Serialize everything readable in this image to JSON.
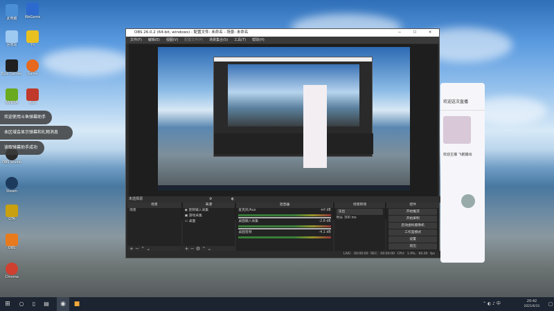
{
  "desktop": {
    "icons": [
      {
        "label": "此电脑",
        "color": "#4a8fd6"
      },
      {
        "label": "回收站",
        "color": "#6aa6e0"
      },
      {
        "label": "Epic Games Launcher",
        "color": "#202020"
      },
      {
        "label": "NVIDIA",
        "color": "#6aaa1e"
      },
      {
        "label": "OBS Studio",
        "color": "#2a2a2a"
      },
      {
        "label": "Steam",
        "color": "#1b3a5c"
      },
      {
        "label": "GTA",
        "color": "#c8a010"
      },
      {
        "label": "OBS",
        "color": "#e87a1e"
      },
      {
        "label": "Chrome",
        "color": "#d04030"
      }
    ],
    "icons_col2": [
      {
        "label": "WeGame",
        "color": "#2d6ad0"
      },
      {
        "label": "Ys",
        "color": "#e8c020"
      },
      {
        "label": "Game",
        "color": "#e6691e"
      },
      {
        "label": "Tool",
        "color": "#c0392b"
      }
    ]
  },
  "toasts": [
    "欢迎使用斗鱼弹幕助手",
    "本区域会显示弹幕和礼物消息",
    "读取弹幕助手成功"
  ],
  "obs": {
    "title": "OBS 26.0.2 (64-bit, windows) - 配置文件: 未命名 - 场景: 未命名",
    "menu": [
      "文件(F)",
      "编辑(E)",
      "视图(V)",
      "配置文件(P)",
      "场景集合(S)",
      "工具(T)",
      "帮助(H)"
    ],
    "no_source": "未选择源",
    "docks": {
      "scenes": {
        "title": "场景",
        "items": [
          "场景"
        ]
      },
      "sources": {
        "title": "来源",
        "items": [
          "音频输入采集",
          "游戏采集",
          "桌面"
        ]
      },
      "mixer": {
        "title": "混音器",
        "channels": [
          {
            "name": "麦克风/Aux",
            "db": "-inf dB"
          },
          {
            "name": "桌面输入采集",
            "db": "-2.8 dB"
          },
          {
            "name": "桌面音频",
            "db": "-4.1 dB"
          }
        ]
      },
      "transitions": {
        "title": "场景转场",
        "type": "淡出",
        "duration_label": "时长",
        "duration": "300 ms"
      },
      "controls": {
        "title": "控件",
        "buttons": [
          "开始推流",
          "开始录制",
          "启动虚拟摄像机",
          "工作室模式",
          "设置",
          "退出"
        ]
      }
    },
    "status": {
      "live": "LIVE: 00:00:00",
      "rec": "REC: 00:00:00",
      "cpu": "CPU: 1.9%, 60.00 fps"
    }
  },
  "chat_panel": {
    "line1": "欢迎这次直播",
    "line2": "欢迎主播 飞鹅播出"
  },
  "taskbar": {
    "time": "20:42",
    "date": "2021/6/31"
  }
}
